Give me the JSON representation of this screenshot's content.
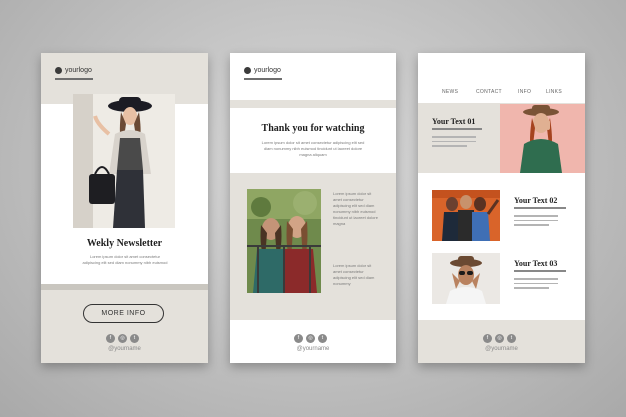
{
  "card1": {
    "logo": "yourlogo",
    "title": "Wekly Newsletter",
    "paragraph": "Lorem ipsum dolor sit amet consectetur adipiscing elit sed diam nonummy nibh euismod",
    "button_label": "MORE INFO",
    "handle": "@yourname"
  },
  "card2": {
    "logo": "yourlogo",
    "title": "Thank you for watching",
    "paragraph": "Lorem ipsum dolor sit amet consectetur adipiscing elit sed diam nonummy nibh euismod tincidunt ut laoreet dolore magna aliquam",
    "text_block_1": "Lorem ipsum dolor sit amet consectetur adipiscing elit sed diam nonummy nibh euismod tincidunt ut laoreet dolore magna",
    "text_block_2": "Lorem ipsum dolor sit amet consectetur adipiscing elit sed diam nonummy",
    "handle": "@yourname"
  },
  "card3": {
    "nav": [
      "NEWS",
      "CONTACT",
      "INFO",
      "LINKS"
    ],
    "heading1": "Your Text 01",
    "heading2": "Your Text 02",
    "heading3": "Your Text 03",
    "handle": "@yourname"
  },
  "social_icons": [
    "facebook-icon",
    "instagram-icon",
    "twitter-icon"
  ],
  "colors": {
    "beige": "#e4e1db",
    "pink": "#f0b6ad",
    "orange_wall": "#d9642a"
  }
}
